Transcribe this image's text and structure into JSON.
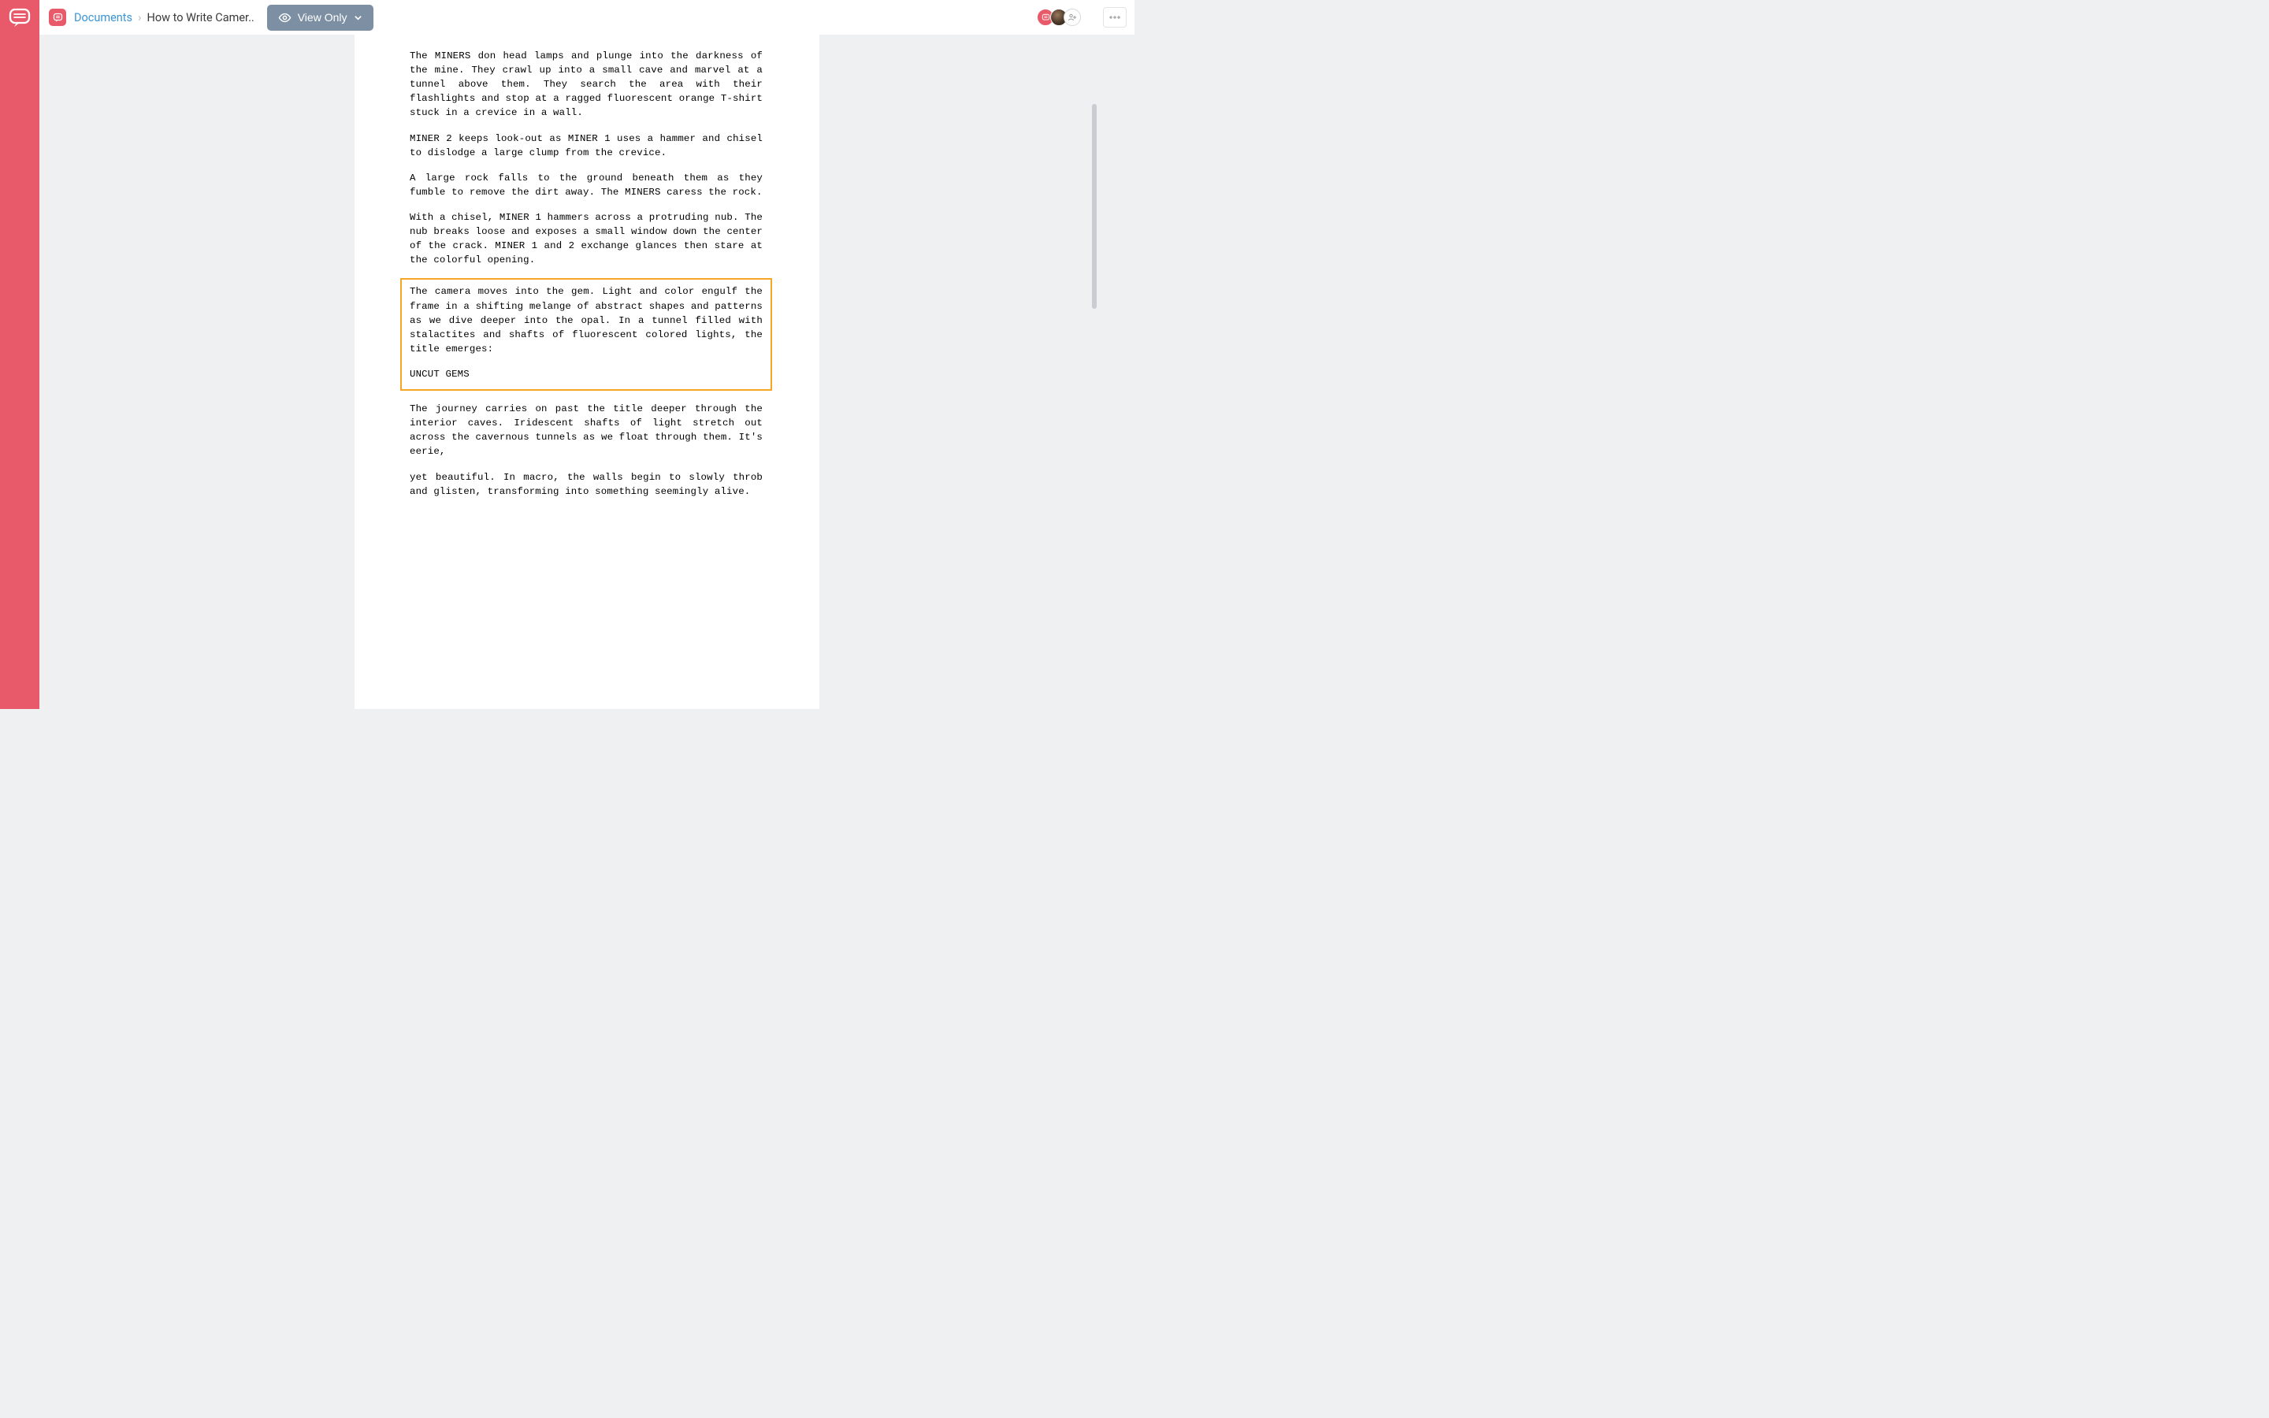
{
  "breadcrumb": {
    "root": "Documents",
    "current": "How to Write Camer.."
  },
  "toolbar": {
    "view_label": "View Only"
  },
  "script": {
    "p1": "The MINERS don head lamps and plunge into the darkness of the mine. They crawl up into a small cave and marvel at a tunnel above them. They search the area with their flashlights and stop at a ragged fluorescent orange T-shirt stuck in a crevice in a wall.",
    "p2": "MINER 2 keeps look-out as MINER 1 uses a hammer and chisel to dislodge a large clump from the crevice.",
    "p3": "A large rock falls to the ground beneath them as they fumble to remove the dirt away. The MINERS caress the rock.",
    "p4": "With a chisel, MINER 1 hammers across a protruding nub. The nub breaks loose and exposes a small window down the center of the crack. MINER 1 and 2 exchange glances then stare at the colorful opening.",
    "hp1": "The camera moves into the gem. Light and color engulf the frame in a shifting melange of abstract shapes and patterns as we dive deeper into the opal. In a tunnel filled with stalactites and shafts of fluorescent colored lights, the title emerges:",
    "hp2": "UNCUT GEMS",
    "p5": "The journey carries on past the title deeper through the interior caves. Iridescent shafts of light stretch out across the cavernous tunnels as we float through them. It's eerie,",
    "p6": "yet beautiful. In macro, the walls begin to slowly throb and glisten, transforming into something seemingly alive."
  }
}
